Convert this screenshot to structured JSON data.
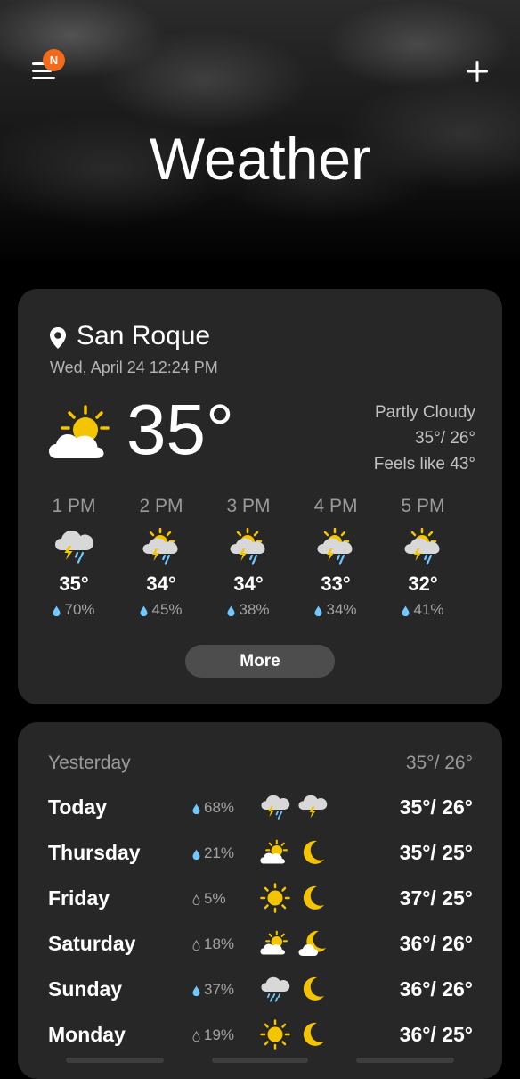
{
  "header": {
    "menu_icon": "hamburger-menu-icon",
    "badge": "N",
    "add_icon": "plus-icon",
    "title": "Weather"
  },
  "current": {
    "location_icon": "location-pin-icon",
    "location": "San Roque",
    "datetime": "Wed, April 24 12:24 PM",
    "condition_icon": "partly-cloudy-icon",
    "temperature": "35°",
    "condition": "Partly Cloudy",
    "high_low": "35°/ 26°",
    "feels_like": "Feels like 43°"
  },
  "hourly": [
    {
      "time": "1 PM",
      "icon": "thunderstorm-rain-icon",
      "temp": "35°",
      "precip": "70%"
    },
    {
      "time": "2 PM",
      "icon": "sun-thunderstorm-rain-icon",
      "temp": "34°",
      "precip": "45%"
    },
    {
      "time": "3 PM",
      "icon": "sun-thunderstorm-rain-icon",
      "temp": "34°",
      "precip": "38%"
    },
    {
      "time": "4 PM",
      "icon": "sun-thunderstorm-rain-icon",
      "temp": "33°",
      "precip": "34%"
    },
    {
      "time": "5 PM",
      "icon": "sun-thunderstorm-rain-icon",
      "temp": "32°",
      "precip": "41%"
    }
  ],
  "more_label": "More",
  "yesterday": {
    "label": "Yesterday",
    "temps": "35°/ 26°"
  },
  "daily": [
    {
      "day": "Today",
      "precip": "68%",
      "day_icon": "thunderstorm-rain-icon",
      "night_icon": "thunderstorm-icon",
      "temps": "35°/ 26°"
    },
    {
      "day": "Thursday",
      "precip": "21%",
      "day_icon": "partly-cloudy-icon",
      "night_icon": "moon-icon",
      "temps": "35°/ 25°"
    },
    {
      "day": "Friday",
      "precip": "5%",
      "day_icon": "sun-icon",
      "night_icon": "moon-icon",
      "temps": "37°/ 25°"
    },
    {
      "day": "Saturday",
      "precip": "18%",
      "day_icon": "partly-cloudy-icon",
      "night_icon": "moon-cloud-icon",
      "temps": "36°/ 26°"
    },
    {
      "day": "Sunday",
      "precip": "37%",
      "day_icon": "cloud-rain-icon",
      "night_icon": "moon-icon",
      "temps": "36°/ 26°"
    },
    {
      "day": "Monday",
      "precip": "19%",
      "day_icon": "sun-icon",
      "night_icon": "moon-icon",
      "temps": "36°/ 25°"
    }
  ],
  "colors": {
    "background": "#000000",
    "card": "#272727",
    "badge": "#f26b1d",
    "sun": "#f5c400",
    "cloud": "#ffffff",
    "rain": "#6fc8ff"
  }
}
